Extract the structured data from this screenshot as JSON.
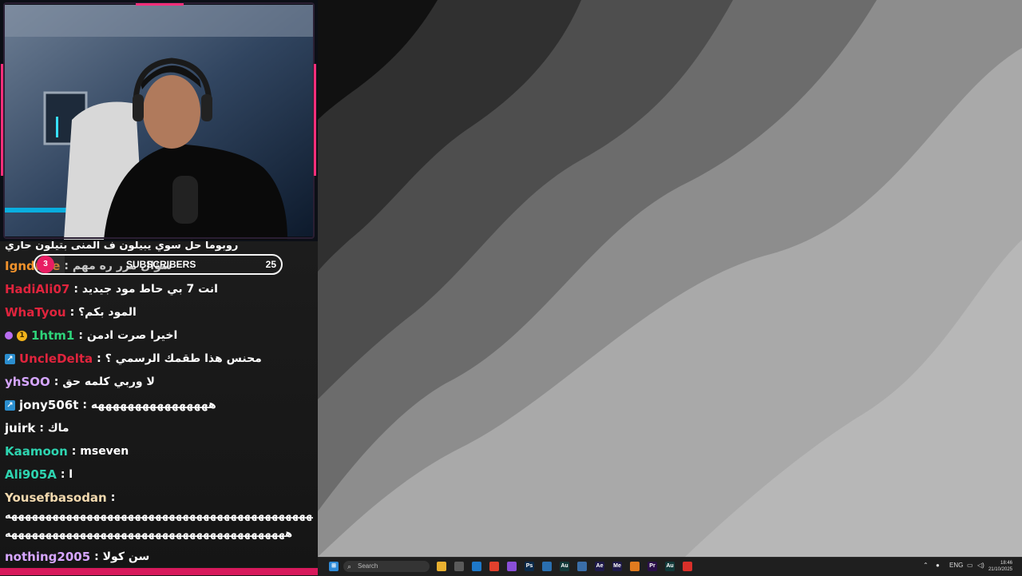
{
  "chat": {
    "messages": [
      {
        "user": "",
        "user_color": "#ffffff",
        "text": "روبوما حل سوي يبيلون ف المنى بتيلون حاري"
      },
      {
        "user": "Igndrise",
        "user_color": "#f0922c",
        "text": ": سؤال مرر ره مهم"
      },
      {
        "user": "HadiAli07",
        "user_color": "#e0243d",
        "text": ": انت 7 بي حاط مود جيديد"
      },
      {
        "user": "WhaTyou",
        "user_color": "#e0243d",
        "text": ": المود بكم؟"
      },
      {
        "user": "1htm1",
        "user_color": "#2ed47a",
        "text": ": اخيرا صرت ادمن",
        "badges": [
          "dot",
          "coin"
        ]
      },
      {
        "user": "UncleDelta",
        "user_color": "#e0243d",
        "text": ": محنس هذا طقمك الرسمي ؟",
        "badges": [
          "arrow"
        ]
      },
      {
        "user": "yhSOO",
        "user_color": "#d6a6ff",
        "text": ": لا وربي كلمه حق"
      },
      {
        "user": "jony506t",
        "user_color": "#ffffff",
        "text": ": ههههههههههههههههه",
        "badges": [
          "arrow"
        ]
      },
      {
        "user": "juirk",
        "user_color": "#ffffff",
        "text": ": ماك"
      },
      {
        "user": "Kaamoon",
        "user_color": "#2ed4b0",
        "text": ": mseven"
      },
      {
        "user": "Ali905A",
        "user_color": "#2ed4b0",
        "text": ": ا"
      },
      {
        "user": "Yousefbasodan",
        "user_color": "#f2d9ae",
        "text": ":"
      },
      {
        "user": "",
        "user_color": "#ffffff",
        "text": "هههههههههههههههههههههههههههههههههههههههههههههه"
      },
      {
        "user": "",
        "user_color": "#ffffff",
        "text": "هههههههههههههههههههههههههههههههههههههههههه"
      },
      {
        "user": "nothing2005",
        "user_color": "#d6a6ff",
        "text": ": سن كولا"
      }
    ]
  },
  "subscribers": {
    "label": "SUBSCRIBERS",
    "current": "3",
    "goal": "25",
    "progress": 0.12
  },
  "taskbar": {
    "search_placeholder": "Search",
    "apps": [
      {
        "name": "windows",
        "glyph": "",
        "color": "#2f8bd8"
      },
      {
        "name": "file-explorer",
        "glyph": "",
        "color": "#e8b030"
      },
      {
        "name": "store",
        "glyph": "",
        "color": "#5a5a5a"
      },
      {
        "name": "vscode",
        "glyph": "",
        "color": "#1e78c8"
      },
      {
        "name": "brave",
        "glyph": "",
        "color": "#e2412d"
      },
      {
        "name": "visual-studio",
        "glyph": "",
        "color": "#8a4fd8"
      },
      {
        "name": "photoshop",
        "glyph": "Ps",
        "color": "#0b2a4a"
      },
      {
        "name": "app-blue",
        "glyph": "",
        "color": "#2a6fb0"
      },
      {
        "name": "audition",
        "glyph": "Au",
        "color": "#123a3a"
      },
      {
        "name": "calculator",
        "glyph": "",
        "color": "#3a6ea8"
      },
      {
        "name": "after-effects",
        "glyph": "Ae",
        "color": "#1e1a4a"
      },
      {
        "name": "media-encoder",
        "glyph": "Me",
        "color": "#1e1a4a"
      },
      {
        "name": "blender",
        "glyph": "",
        "color": "#e07b1f"
      },
      {
        "name": "premiere",
        "glyph": "Pr",
        "color": "#2a0f4a"
      },
      {
        "name": "audition-2",
        "glyph": "Au",
        "color": "#123a3a"
      },
      {
        "name": "chrome-red",
        "glyph": "",
        "color": "#d9302a"
      }
    ],
    "tray": {
      "lang": "ENG",
      "time": "18:46",
      "date": "21/10/2025"
    }
  }
}
